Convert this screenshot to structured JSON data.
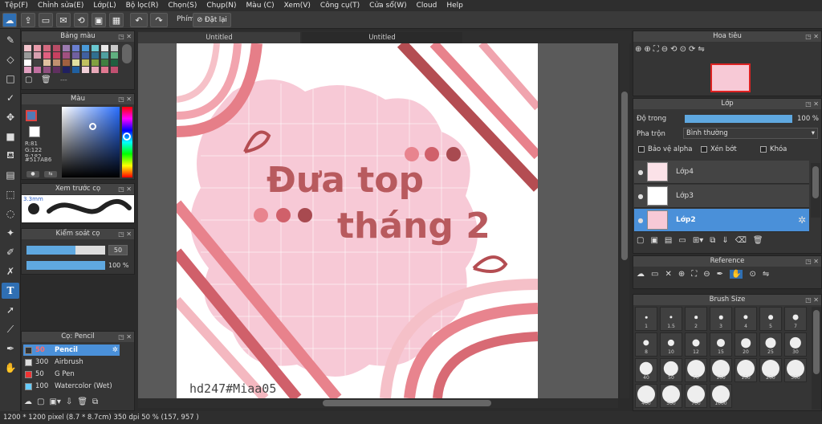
{
  "menu": [
    "Tệp(F)",
    "Chỉnh sửa(E)",
    "Lớp(L)",
    "Bộ lọc(R)",
    "Chọn(S)",
    "Chụp(N)",
    "Màu (C)",
    "Xem(V)",
    "Công cụ(T)",
    "Cửa sổ(W)",
    "Cloud",
    "Help"
  ],
  "toolbar": {
    "shortcut_label": "Phím",
    "reset_label": "Đặt lại"
  },
  "tabs": [
    "Untitled",
    "Untitled"
  ],
  "palette": {
    "title": "Bảng màu",
    "placeholder": "---",
    "swatches": [
      "#f2c4cc",
      "#e89aaa",
      "#d46a80",
      "#b84c66",
      "#9c7bb0",
      "#6a7fd0",
      "#4a9ad8",
      "#6ac8d0",
      "#e8e8e8",
      "#c8c8c8",
      "#9a9a9a",
      "#d8a0b0",
      "#e06080",
      "#c84060",
      "#a05080",
      "#7060a0",
      "#4060a0",
      "#307090",
      "#50a0a0",
      "#60b080",
      "#ffffff",
      "#404040",
      "#e0c0a0",
      "#c09070",
      "#a06040",
      "#e0e0a0",
      "#c0c060",
      "#80a040",
      "#408040",
      "#206040",
      "#e0a0c0",
      "#c070a0",
      "#905080",
      "#603060",
      "#202060",
      "#2060a0",
      "#f0d0d8",
      "#e8a8b8",
      "#e07890",
      "#c05070"
    ]
  },
  "color": {
    "title": "Màu",
    "r": "R:81",
    "g": "G:122",
    "b": "B:182",
    "hex": "#517AB6"
  },
  "brush_preview": {
    "title": "Xem trước cọ",
    "size": "3.3mm"
  },
  "brush_control": {
    "title": "Kiểm soát cọ",
    "size": "50",
    "opacity": "100 %",
    "size_value": 0.62,
    "opacity_value": 1.0
  },
  "brushes": {
    "title": "Cọ: Pencil",
    "items": [
      {
        "size": "50",
        "name": "Pencil",
        "color": "#333",
        "selected": true
      },
      {
        "size": "300",
        "name": "Airbrush",
        "color": "#ddd",
        "selected": false
      },
      {
        "size": "50",
        "name": "G Pen",
        "color": "#e33",
        "selected": false
      },
      {
        "size": "100",
        "name": "Watercolor (Wet)",
        "color": "#6cf",
        "selected": false
      }
    ]
  },
  "canvas": {
    "title_line1": "Đưa top",
    "title_line2": "tháng 2",
    "watermark": "hd247#Miaa05"
  },
  "navigator": {
    "title": "Hoa tiêu"
  },
  "layers": {
    "title": "Lớp",
    "opacity_label": "Độ trong",
    "opacity_value": "100 %",
    "opacity_fill": 1.0,
    "blend_label": "Pha trộn",
    "blend_value": "Bình thường",
    "protect_alpha": "Bảo vệ alpha",
    "clipping": "Xén bớt",
    "lock": "Khóa",
    "items": [
      {
        "name": "Lớp4",
        "selected": false
      },
      {
        "name": "Lớp3",
        "selected": false
      },
      {
        "name": "Lớp2",
        "selected": true
      }
    ]
  },
  "reference": {
    "title": "Reference"
  },
  "brush_size": {
    "title": "Brush Size",
    "sizes": [
      "1",
      "1.5",
      "2",
      "3",
      "4",
      "5",
      "7",
      "8",
      "10",
      "12",
      "15",
      "20",
      "25",
      "30",
      "40",
      "50",
      "70",
      "100",
      "150",
      "200",
      "300",
      "400",
      "500",
      "700",
      "1000"
    ]
  },
  "status": {
    "text": "1200 * 1200 pixel   (8.7 * 8.7cm)   350 dpi   50 %   (157, 957 )"
  }
}
